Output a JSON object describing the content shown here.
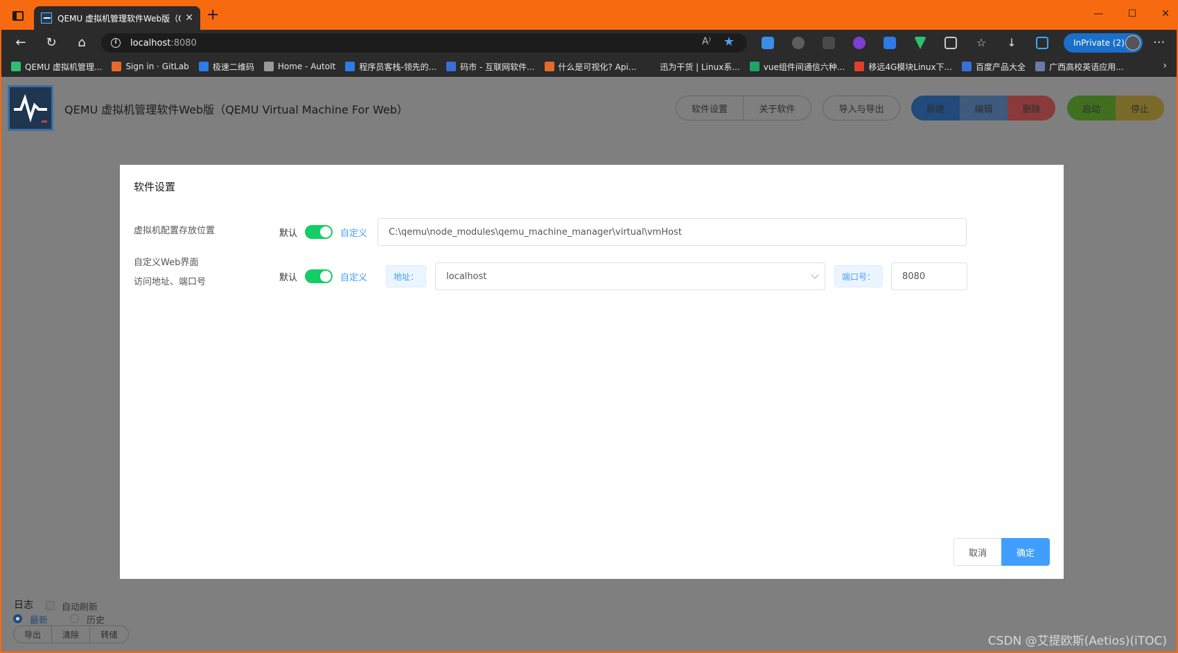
{
  "browser": {
    "tab_title": "QEMU 虚拟机管理软件Web版（Q",
    "tab_close": "✕",
    "new_tab": "+",
    "url_host": "localhost",
    "url_port": ":8080",
    "inprivate_label": "InPrivate (2)",
    "win_controls": [
      "—",
      "☐",
      "✕"
    ],
    "bookmarks": [
      {
        "label": "QEMU 虚拟机管理...",
        "color": "#2fbf71"
      },
      {
        "label": "Sign in · GitLab",
        "color": "#e8692b"
      },
      {
        "label": "极速二维码",
        "color": "#2d7be5"
      },
      {
        "label": "Home - AutoIt",
        "color": "#999999"
      },
      {
        "label": "程序员客栈-领先的...",
        "color": "#2d7be5"
      },
      {
        "label": "码市 - 互联网软件...",
        "color": "#3a6fd9"
      },
      {
        "label": "什么是可视化? Api...",
        "color": "#e8692b"
      },
      {
        "label": "迅为干货 | Linux系...",
        "color": "#2b2b2b"
      },
      {
        "label": "vue组件间通信六种...",
        "color": "#1fa463"
      },
      {
        "label": "移远4G模块Linux下...",
        "color": "#e0402b"
      },
      {
        "label": "百度产品大全",
        "color": "#3a6fd9"
      },
      {
        "label": "广西高校英语应用...",
        "color": "#6a7ba8"
      }
    ]
  },
  "app": {
    "title": "QEMU 虚拟机管理软件Web版（QEMU Virtual Machine For Web）",
    "toolbar": {
      "settings": "软件设置",
      "about": "关于软件",
      "import_export": "导入与导出",
      "new": "新建",
      "edit": "编辑",
      "delete": "删除",
      "start": "启动",
      "stop": "停止"
    },
    "colors": {
      "new": "#224a7a",
      "edit": "#3e5a7d",
      "delete": "#8a3a3a",
      "start": "#3f6f1f",
      "stop": "#7a6a2a"
    }
  },
  "log": {
    "title": "日志",
    "auto_refresh": "自动刷新",
    "latest": "最新",
    "history": "历史",
    "export": "导出",
    "clear": "清除",
    "dump": "转储"
  },
  "modal": {
    "title": "软件设置",
    "vm_path": {
      "label": "虚拟机配置存放位置",
      "default": "默认",
      "custom": "自定义",
      "value": "C:\\qemu\\node_modules\\qemu_machine_manager\\virtual\\vmHost"
    },
    "web": {
      "label_line1": "自定义Web界面",
      "label_line2": "访问地址、端口号",
      "default": "默认",
      "custom": "自定义",
      "address_tag": "地址：",
      "address_value": "localhost",
      "port_tag": "端口号：",
      "port_value": "8080"
    },
    "cancel": "取消",
    "confirm": "确定"
  },
  "watermark": "CSDN @艾提欧斯(Aetios)(iTOC)"
}
